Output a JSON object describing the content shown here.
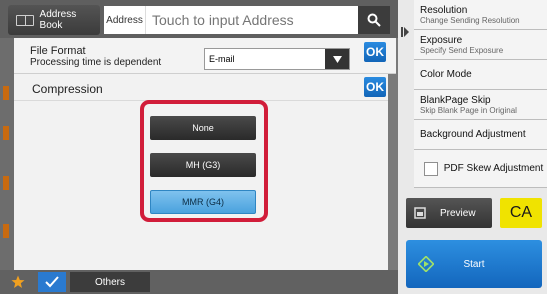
{
  "topbar": {
    "address_book_label": "Address Book",
    "address_label": "Address",
    "address_placeholder": "Touch to input Address",
    "search_icon": "magnifier-icon"
  },
  "file_format": {
    "title": "File Format",
    "subtitle": "Processing time is dependent",
    "selected_value": "E-mail",
    "ok_label": "OK"
  },
  "compression": {
    "title": "Compression",
    "ok_label": "OK",
    "options": [
      "None",
      "MH (G3)",
      "MMR (G4)"
    ],
    "selected": "MMR (G4)",
    "highlight_color": "#d11d3a"
  },
  "bottombar": {
    "others_label": "Others",
    "star_icon": "star-icon",
    "check_icon": "check-icon"
  },
  "settings": {
    "items": [
      {
        "title": "Resolution",
        "subtitle": "Change Sending Resolution"
      },
      {
        "title": "Exposure",
        "subtitle": "Specify Send Exposure"
      },
      {
        "title": "Color Mode",
        "subtitle": ""
      },
      {
        "title": "BlankPage Skip",
        "subtitle": "Skip Blank Page in Original"
      },
      {
        "title": "Background Adjustment",
        "subtitle": ""
      }
    ],
    "pdf_skew_label": "PDF Skew Adjustment"
  },
  "actions": {
    "preview_label": "Preview",
    "ca_label": "CA",
    "start_label": "Start"
  },
  "colors": {
    "accent_blue": "#1e7bd3",
    "ca_yellow": "#f0e300"
  }
}
